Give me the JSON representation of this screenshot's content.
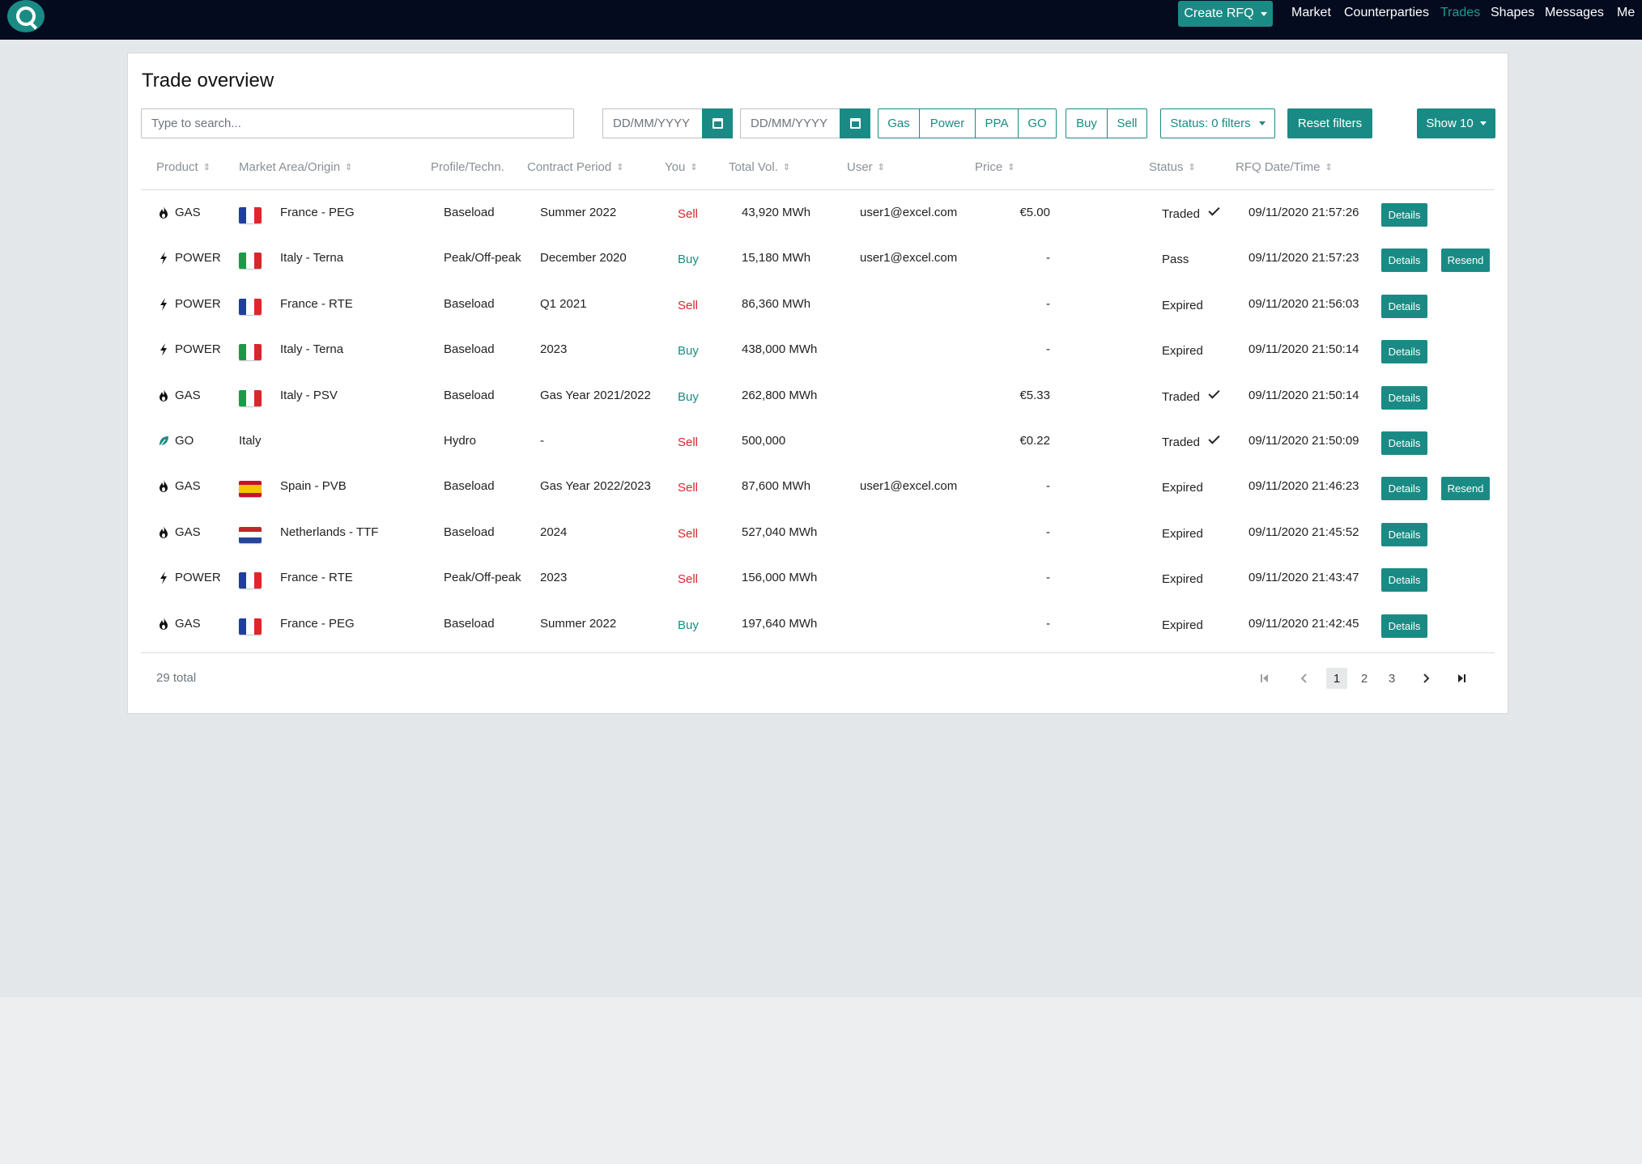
{
  "nav": {
    "create_rfq": "Create RFQ",
    "links": [
      "Market",
      "Counterparties",
      "Trades",
      "Shapes",
      "Messages",
      "Me"
    ],
    "active": "Trades"
  },
  "page": {
    "title": "Trade overview"
  },
  "filters": {
    "search_placeholder": "Type to search...",
    "date_from_placeholder": "DD/MM/YYYY",
    "date_to_placeholder": "DD/MM/YYYY",
    "products": [
      "Gas",
      "Power",
      "PPA",
      "GO"
    ],
    "sides": [
      "Buy",
      "Sell"
    ],
    "status": "Status: 0 filters",
    "reset": "Reset filters",
    "show": "Show 10"
  },
  "table": {
    "headers": {
      "product": "Product",
      "market": "Market Area/Origin",
      "profile": "Profile/Techn.",
      "period": "Contract Period",
      "you": "You",
      "volume": "Total Vol.",
      "user": "User",
      "price": "Price",
      "status": "Status",
      "rfq": "RFQ Date/Time"
    },
    "details_label": "Details",
    "resend_label": "Resend",
    "rows": [
      {
        "icon": "flame-icon",
        "product": "GAS",
        "flag": "fr",
        "market": "France - PEG",
        "profile": "Baseload",
        "period": "Summer 2022",
        "side": "Sell",
        "volume": "43,920 MWh",
        "user": "user1@excel.com",
        "price": "€5.00",
        "status": "Traded",
        "checked": true,
        "rfq": "09/11/2020 21:57:26",
        "resend": false
      },
      {
        "icon": "bolt-icon",
        "product": "POWER",
        "flag": "it",
        "market": "Italy - Terna",
        "profile": "Peak/Off-peak",
        "period": "December 2020",
        "side": "Buy",
        "volume": "15,180 MWh",
        "user": "user1@excel.com",
        "price": "-",
        "status": "Pass",
        "checked": false,
        "rfq": "09/11/2020 21:57:23",
        "resend": true
      },
      {
        "icon": "bolt-icon",
        "product": "POWER",
        "flag": "fr",
        "market": "France - RTE",
        "profile": "Baseload",
        "period": "Q1 2021",
        "side": "Sell",
        "volume": "86,360 MWh",
        "user": "",
        "price": "-",
        "status": "Expired",
        "checked": false,
        "rfq": "09/11/2020 21:56:03",
        "resend": false
      },
      {
        "icon": "bolt-icon",
        "product": "POWER",
        "flag": "it",
        "market": "Italy - Terna",
        "profile": "Baseload",
        "period": "2023",
        "side": "Buy",
        "volume": "438,000 MWh",
        "user": "",
        "price": "-",
        "status": "Expired",
        "checked": false,
        "rfq": "09/11/2020 21:50:14",
        "resend": false
      },
      {
        "icon": "flame-icon",
        "product": "GAS",
        "flag": "it",
        "market": "Italy - PSV",
        "profile": "Baseload",
        "period": "Gas Year 2021/2022",
        "side": "Buy",
        "volume": "262,800 MWh",
        "user": "",
        "price": "€5.33",
        "status": "Traded",
        "checked": true,
        "rfq": "09/11/2020 21:50:14",
        "resend": false
      },
      {
        "icon": "leaf-icon",
        "product": "GO",
        "flag": "",
        "market": "Italy",
        "profile": "Hydro",
        "period": "-",
        "side": "Sell",
        "volume": "500,000",
        "user": "",
        "price": "€0.22",
        "status": "Traded",
        "checked": true,
        "rfq": "09/11/2020 21:50:09",
        "resend": false
      },
      {
        "icon": "flame-icon",
        "product": "GAS",
        "flag": "es",
        "market": "Spain - PVB",
        "profile": "Baseload",
        "period": "Gas Year 2022/2023",
        "side": "Sell",
        "volume": "87,600 MWh",
        "user": "user1@excel.com",
        "price": "-",
        "status": "Expired",
        "checked": false,
        "rfq": "09/11/2020 21:46:23",
        "resend": true
      },
      {
        "icon": "flame-icon",
        "product": "GAS",
        "flag": "nl",
        "market": "Netherlands - TTF",
        "profile": "Baseload",
        "period": "2024",
        "side": "Sell",
        "volume": "527,040 MWh",
        "user": "",
        "price": "-",
        "status": "Expired",
        "checked": false,
        "rfq": "09/11/2020 21:45:52",
        "resend": false
      },
      {
        "icon": "bolt-icon",
        "product": "POWER",
        "flag": "fr",
        "market": "France - RTE",
        "profile": "Peak/Off-peak",
        "period": "2023",
        "side": "Sell",
        "volume": "156,000 MWh",
        "user": "",
        "price": "-",
        "status": "Expired",
        "checked": false,
        "rfq": "09/11/2020 21:43:47",
        "resend": false
      },
      {
        "icon": "flame-icon",
        "product": "GAS",
        "flag": "fr",
        "market": "France - PEG",
        "profile": "Baseload",
        "period": "Summer 2022",
        "side": "Buy",
        "volume": "197,640 MWh",
        "user": "",
        "price": "-",
        "status": "Expired",
        "checked": false,
        "rfq": "09/11/2020 21:42:45",
        "resend": false
      }
    ]
  },
  "footer": {
    "total": "29 total",
    "pages": [
      "1",
      "2",
      "3"
    ],
    "current_page": "1"
  },
  "colors": {
    "accent": "#1a8b84",
    "sell": "#d9262b",
    "nav_bg": "#050b1f"
  }
}
